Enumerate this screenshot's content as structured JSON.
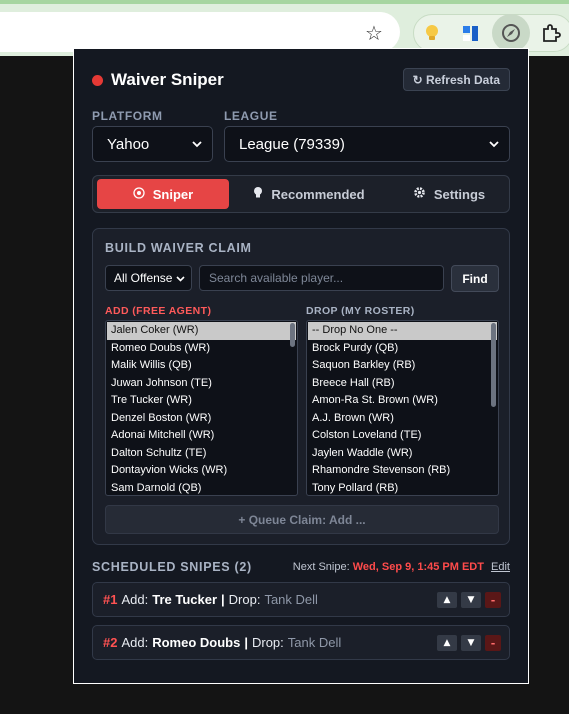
{
  "browser": {
    "bookmark_icon": "star-outline-icon",
    "extensions": [
      "lightbulb-icon",
      "tool-icon",
      "compass-icon",
      "puzzle-icon"
    ]
  },
  "popup": {
    "title": "Waiver Sniper",
    "refresh_label": "↻ Refresh Data",
    "platform": {
      "label": "PLATFORM",
      "value": "Yahoo"
    },
    "league": {
      "label": "LEAGUE",
      "value": "League (79339)"
    },
    "tabs": [
      {
        "label": "Sniper",
        "icon": "target-icon",
        "active": true
      },
      {
        "label": "Recommended",
        "icon": "lightbulb-icon",
        "active": false
      },
      {
        "label": "Settings",
        "icon": "gear-icon",
        "active": false
      }
    ],
    "build": {
      "title": "BUILD WAIVER CLAIM",
      "filter_value": "All Offense",
      "search_placeholder": "Search available player...",
      "find_label": "Find",
      "add_label": "ADD (FREE AGENT)",
      "drop_label": "DROP (MY ROSTER)",
      "add_options": [
        "Jalen Coker (WR)",
        "Romeo Doubs (WR)",
        "Malik Willis (QB)",
        "Juwan Johnson (TE)",
        "Tre Tucker (WR)",
        "Denzel Boston (WR)",
        "Adonai Mitchell (WR)",
        "Dalton Schultz (TE)",
        "Dontayvion Wicks (WR)",
        "Sam Darnold (QB)"
      ],
      "drop_options": [
        "-- Drop No One --",
        "Brock Purdy (QB)",
        "Saquon Barkley (RB)",
        "Breece Hall (RB)",
        "Amon-Ra St. Brown (WR)",
        "A.J. Brown (WR)",
        "Colston Loveland (TE)",
        "Jaylen Waddle (WR)",
        "Rhamondre Stevenson (RB)",
        "Tony Pollard (RB)"
      ],
      "queue_label": "+ Queue Claim: Add ..."
    },
    "scheduled": {
      "title": "SCHEDULED SNIPES (2)",
      "next_label": "Next Snipe:",
      "next_time": "Wed, Sep 9, 1:45 PM EDT",
      "edit_label": "Edit",
      "items": [
        {
          "num": "#1",
          "add_label": "Add:",
          "player": "Tre Tucker",
          "sep": "|",
          "drop_label": "Drop:",
          "drop": "Tank Dell",
          "up": "▲",
          "down": "▼",
          "remove": "-"
        },
        {
          "num": "#2",
          "add_label": "Add:",
          "player": "Romeo Doubs",
          "sep": "|",
          "drop_label": "Drop:",
          "drop": "Tank Dell",
          "up": "▲",
          "down": "▼",
          "remove": "-"
        }
      ]
    }
  },
  "colors": {
    "accent": "#e64545",
    "popup_bg": "#141821",
    "card_bg": "#1b1f29",
    "chrome_bg": "#dfeedd"
  }
}
